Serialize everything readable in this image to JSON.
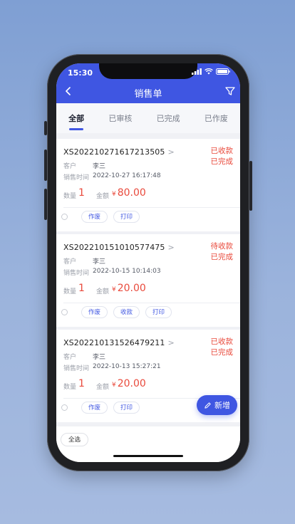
{
  "status_bar": {
    "time": "15:30"
  },
  "nav": {
    "title": "销售单"
  },
  "tabs": [
    "全部",
    "已审核",
    "已完成",
    "已作废"
  ],
  "labels": {
    "customer": "客户",
    "sale_time": "销售时间",
    "quantity": "数量",
    "amount": "金额",
    "currency": "¥"
  },
  "orders": [
    {
      "no": "XS20221027161721350​5",
      "status1": "已收款",
      "status2": "已完成",
      "customer": "李三",
      "time": "2022-10-27 16:17:48",
      "qty": "1",
      "amount": "80.00",
      "actions": [
        "作废",
        "打印"
      ]
    },
    {
      "no": "XS202210151010577475",
      "status1": "待收款",
      "status2": "已完成",
      "customer": "李三",
      "time": "2022-10-15 10:14:03",
      "qty": "1",
      "amount": "20.00",
      "actions": [
        "作废",
        "收款",
        "打印"
      ]
    },
    {
      "no": "XS202210131526479211",
      "status1": "已收款",
      "status2": "已完成",
      "customer": "李三",
      "time": "2022-10-13 15:27:21",
      "qty": "1",
      "amount": "20.00",
      "actions": [
        "作废",
        "打印"
      ]
    }
  ],
  "fab": {
    "label": "新增"
  },
  "bottom": {
    "select_all": "全选"
  },
  "colors": {
    "primary": "#3f56e2",
    "danger": "#e94a3c"
  }
}
